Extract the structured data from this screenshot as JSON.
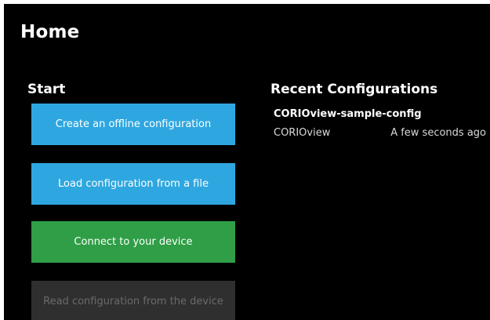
{
  "header": {
    "title": "Home"
  },
  "start": {
    "heading": "Start",
    "buttons": [
      {
        "label": "Create an offline configuration",
        "color": "#2ea7e0",
        "enabled": true
      },
      {
        "label": "Load configuration from a file",
        "color": "#2ea7e0",
        "enabled": true
      },
      {
        "label": "Connect to your device",
        "color": "#2f9e46",
        "enabled": true
      },
      {
        "label": "Read configuration from the device",
        "color": "#2f2f2f",
        "enabled": false
      }
    ]
  },
  "recent": {
    "heading": "Recent Configurations",
    "items": [
      {
        "name": "CORIOview-sample-config",
        "device": "CORIOview",
        "time": "A few seconds ago"
      }
    ]
  },
  "colors": {
    "background": "#000000",
    "accent_blue": "#2ea7e0",
    "accent_green": "#2f9e46",
    "disabled": "#2f2f2f"
  }
}
